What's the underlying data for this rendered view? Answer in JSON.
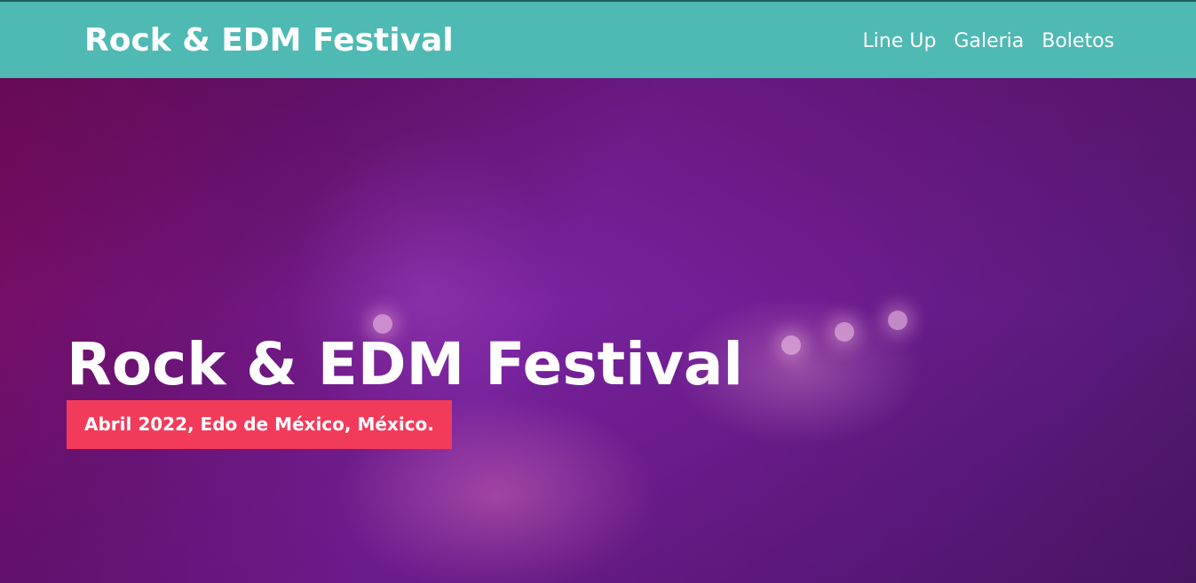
{
  "header": {
    "logo": "Rock & EDM Festival",
    "nav": [
      "Line Up",
      "Galeria",
      "Boletos"
    ]
  },
  "hero": {
    "title": "Rock & EDM Festival",
    "date_location": "Abril 2022, Edo de México, México."
  },
  "colors": {
    "header_bg": "#4fb9b3",
    "badge_bg": "#f23b5b",
    "hero_tint": "#7a22a0"
  }
}
